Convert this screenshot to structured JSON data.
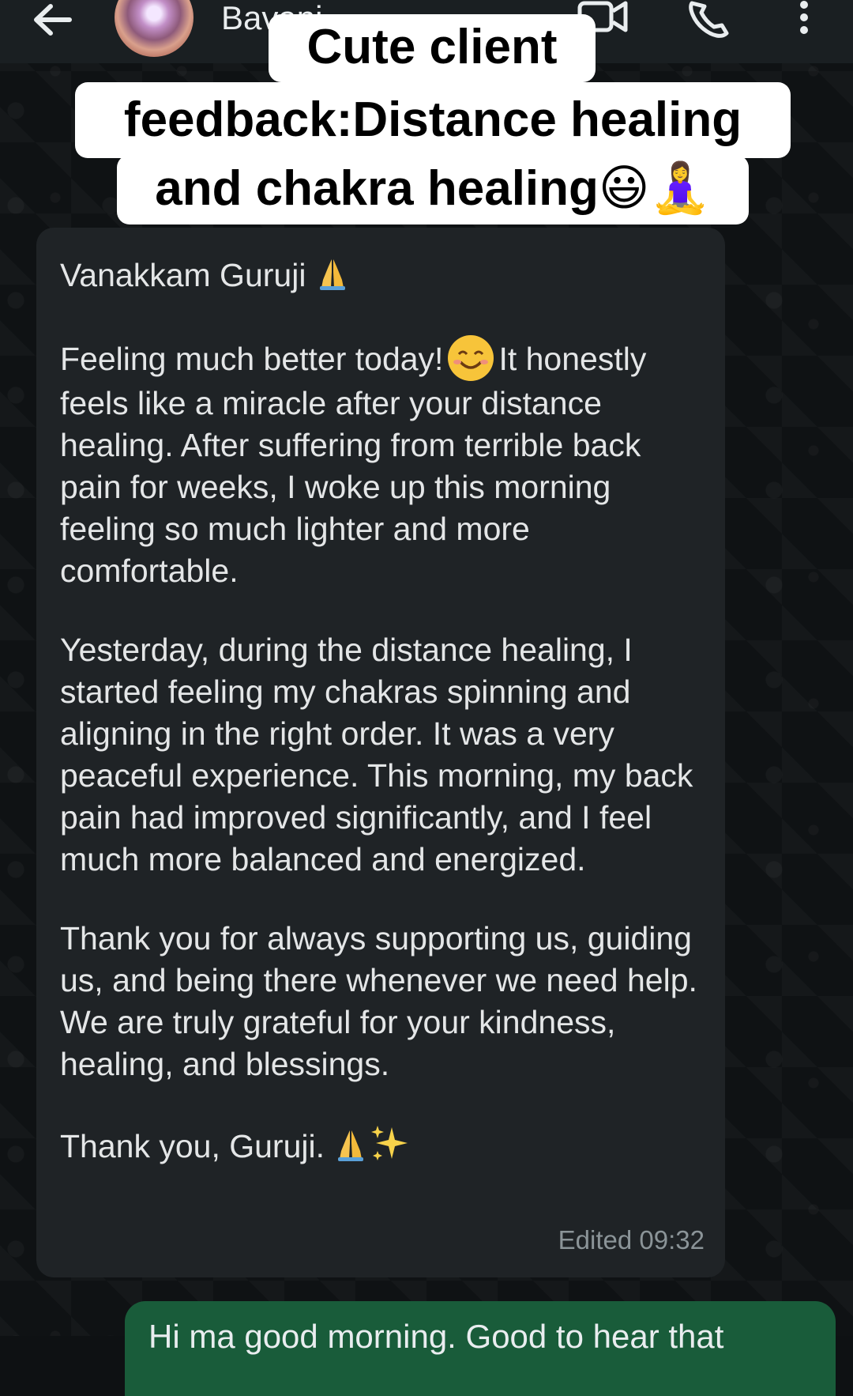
{
  "header": {
    "contact_name": "Bavani",
    "icons": {
      "back": "back-arrow-icon",
      "video": "video-call-icon",
      "call": "phone-call-icon",
      "menu": "more-options-icon"
    }
  },
  "caption": {
    "line1": "Cute client",
    "line2": "feedback:Distance healing",
    "line3": "and chakra healing",
    "line3_emojis": "😃🧘‍♀️"
  },
  "message_in": {
    "greeting": "Vanakkam Guruji",
    "p1_start": "Feeling much better today!",
    "p1_rest": "It honestly feels like a miracle after your distance healing. After suffering from terrible back pain for weeks, I woke up this morning feeling so much lighter and more comfortable.",
    "p2": "Yesterday, during the distance healing, I started feeling my chakras spinning and aligning in the right order. It was a very peaceful experience. This morning, my back pain had improved significantly, and I feel much more balanced and energized.",
    "p3": "Thank you for always supporting us, guiding us, and being there whenever we need help. We are truly grateful for your kindness, healing, and blessings.",
    "closing": "Thank you, Guruji.",
    "timestamp": "Edited 09:32"
  },
  "message_out": {
    "text": "Hi ma good morning. Good to hear that"
  },
  "colors": {
    "background": "#0f1214",
    "incoming_bubble": "#1f2326",
    "outgoing_bubble": "#195c3a",
    "caption_bg": "#ffffff"
  }
}
